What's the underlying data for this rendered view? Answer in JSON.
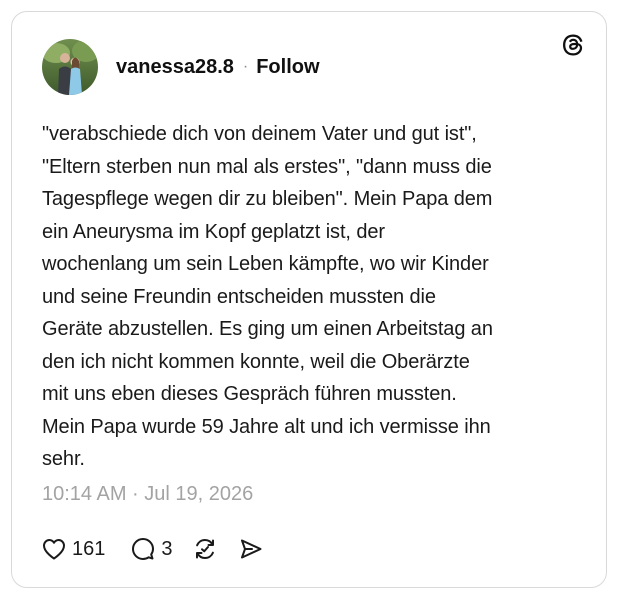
{
  "post": {
    "username": "vanessa28.8",
    "separator": "·",
    "follow_label": "Follow",
    "text": "\"verabschiede dich von deinem Vater und gut ist\",\n\"Eltern sterben nun mal als erstes\", \"dann muss die\nTagespflege wegen dir zu bleiben\". Mein Papa dem\nein Aneurysma im Kopf geplatzt ist, der\nwochenlang um sein Leben kämpfte, wo wir Kinder\nund seine Freundin entscheiden mussten die\nGeräte abzustellen. Es ging um einen Arbeitstag an\nden ich nicht kommen konnte, weil die Oberärzte\nmit uns eben dieses Gespräch führen mussten.\nMein Papa wurde 59 Jahre alt und ich vermisse ihn\nsehr.",
    "timestamp": "10:14 AM · Jul 19, 2026"
  },
  "actions": {
    "likes": "161",
    "replies": "3"
  },
  "icons": {
    "brand": "threads-logo-icon",
    "like": "heart-icon",
    "reply": "comment-bubble-icon",
    "repost": "repost-icon",
    "share": "send-icon"
  },
  "colors": {
    "text": "#101010",
    "muted": "#a3a3a3",
    "border": "#d9d9d9"
  }
}
